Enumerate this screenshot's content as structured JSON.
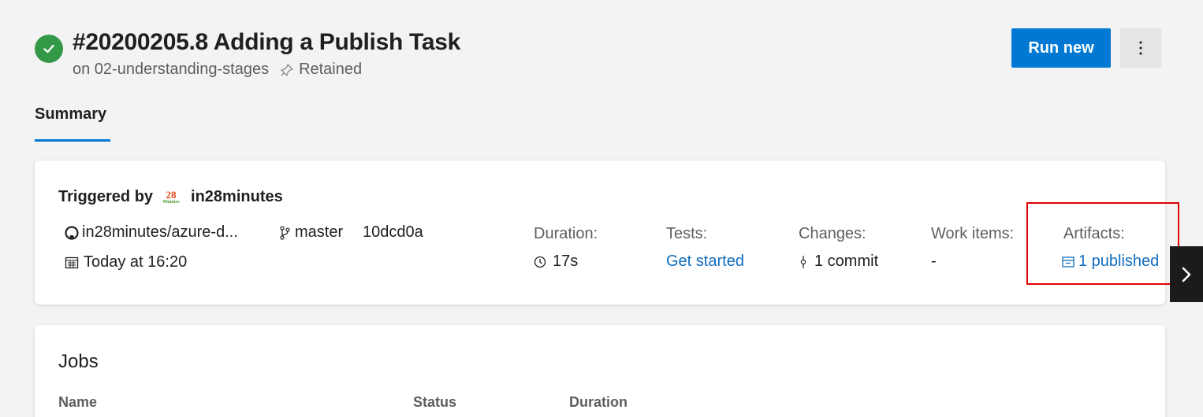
{
  "run": {
    "title": "#20200205.8 Adding a Publish Task",
    "branch_prefix": "on 02-understanding-stages",
    "retained": "Retained",
    "status": "succeeded"
  },
  "actions": {
    "run_new": "Run new",
    "more": "⋮"
  },
  "tabs": [
    {
      "label": "Summary",
      "selected": true
    }
  ],
  "summary": {
    "triggered_by_label": "Triggered by",
    "triggered_by_user": "in28minutes",
    "logo_text_top": "28",
    "logo_text_bottom": "Minutes",
    "repo": "in28minutes/azure-d...",
    "branch": "master",
    "commit_id": "10dcd0a",
    "date": "Today at 16:20",
    "duration_label": "Duration:",
    "duration_value": "17s",
    "tests_label": "Tests:",
    "tests_value": "Get started",
    "changes_label": "Changes:",
    "changes_value": "1 commit",
    "work_items_label": "Work items:",
    "work_items_value": "-",
    "artifacts_label": "Artifacts:",
    "artifacts_value": "1 published"
  },
  "jobs": {
    "title": "Jobs",
    "columns": [
      "Name",
      "Status",
      "Duration"
    ]
  },
  "colors": {
    "accent": "#0078d4",
    "success": "#339947",
    "link": "#0f6cbd",
    "highlight": "#e00000"
  }
}
